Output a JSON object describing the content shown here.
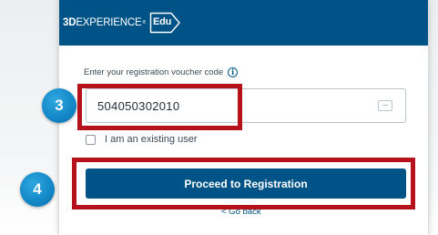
{
  "brand": {
    "strong": "3D",
    "light": "EXPERIENCE",
    "trademark": "®",
    "badge": "Edu"
  },
  "form": {
    "voucher_label": "Enter your registration voucher code",
    "voucher_value": "504050302010",
    "existing_user_label": "I am an existing user",
    "existing_user_checked": false,
    "proceed_label": "Proceed to Registration",
    "go_back_label": "< Go back"
  },
  "annotations": {
    "step_voucher": "3",
    "step_proceed": "4"
  },
  "colors": {
    "header": "#005386",
    "button": "#005386",
    "annotation_frame": "#b5121b",
    "step_badge": "#1286c6"
  },
  "icons": {
    "info": "info-icon",
    "voucher_field": "ticket-icon"
  }
}
